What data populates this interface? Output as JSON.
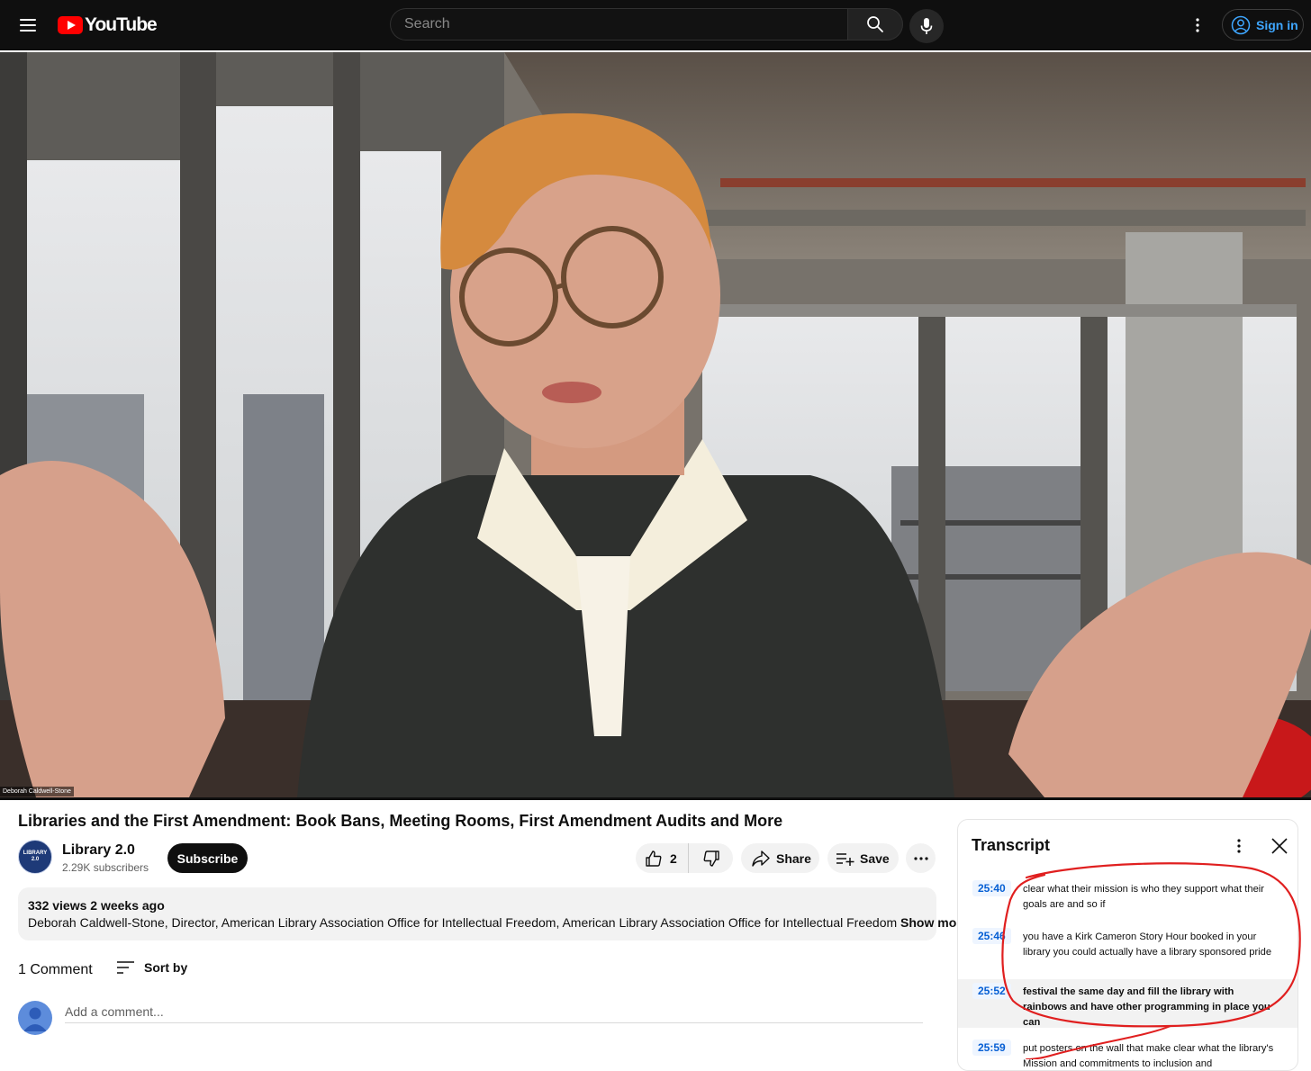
{
  "header": {
    "logo_text": "YouTube",
    "search_placeholder": "Search",
    "signin_label": "Sign in"
  },
  "video": {
    "name_overlay": "Deborah Caldwell-Stone"
  },
  "meta": {
    "title": "Libraries and the First Amendment: Book Bans, Meeting Rooms, First Amendment Audits and More",
    "channel_avatar_line1": "LIBRARY",
    "channel_avatar_line2": "2.0",
    "channel_name": "Library 2.0",
    "subscribers": "2.29K subscribers",
    "subscribe_label": "Subscribe",
    "like_count": "2",
    "share_label": "Share",
    "save_label": "Save"
  },
  "description": {
    "stats": "332 views  2 weeks ago",
    "text": "Deborah Caldwell-Stone, Director, American Library Association Office for Intellectual Freedom, American Library Association Office for Intellectual Freedom",
    "show_more": "Show more"
  },
  "comments": {
    "count_label": "1 Comment",
    "sort_label": "Sort by",
    "input_placeholder": "Add a comment..."
  },
  "transcript": {
    "title": "Transcript",
    "segments": [
      {
        "time": "25:40",
        "text": "clear what their mission is who they support what their goals are and so if"
      },
      {
        "time": "25:46",
        "text": "you have a Kirk Cameron Story Hour booked in your library you could actually have a library sponsored pride"
      },
      {
        "time": "25:52",
        "text": "festival the same day and fill the library with rainbows and have other programming in place you can"
      },
      {
        "time": "25:59",
        "text": "put posters on the wall that make clear what the library's Mission and commitments to inclusion and"
      }
    ]
  },
  "colors": {
    "brand_red": "#ff0000",
    "link_blue": "#065fd4",
    "annotation_red": "#e01f1f"
  }
}
